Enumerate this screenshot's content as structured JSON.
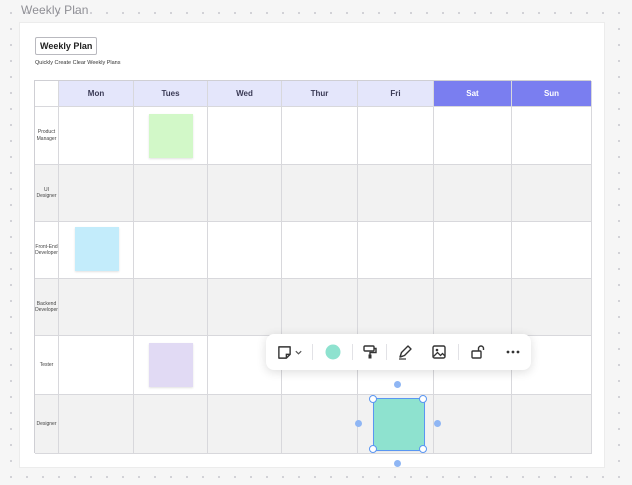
{
  "frame": {
    "title": "Weekly Plan"
  },
  "header": {
    "button_label": "Weekly Plan",
    "subtitle": "Quickly Create Clear Weekly Plans"
  },
  "days": [
    "Mon",
    "Tues",
    "Wed",
    "Thur",
    "Fri",
    "Sat",
    "Sun"
  ],
  "roles": [
    "Product Manager",
    "UI Designer",
    "Front-End Developer",
    "Backend Developer",
    "Tester",
    "Designer"
  ],
  "colors": {
    "header_weekday": "#e4e6fb",
    "header_weekend": "#7a7ef0",
    "row_shade": "#f2f2f2",
    "sticky_green": "#d2f8c8",
    "sticky_blue": "#c3ecfb",
    "sticky_purple": "#e1daf4",
    "sticky_selected": "#8ee2cf",
    "fill_swatch": "#8ee2cf",
    "selection": "#5a96f2"
  },
  "stickies": [
    {
      "role": "Product Manager",
      "day": "Tues",
      "color": "sticky_green",
      "text": ""
    },
    {
      "role": "Front-End Developer",
      "day": "Mon",
      "color": "sticky_blue",
      "text": ""
    },
    {
      "role": "Tester",
      "day": "Tues",
      "color": "sticky_purple",
      "text": ""
    },
    {
      "role": "Designer",
      "day": "Fri",
      "color": "sticky_selected",
      "text": "",
      "selected": true
    }
  ],
  "toolbar": {
    "items": [
      "sticky-note-icon",
      "chevron-down-icon",
      "fill-color-swatch",
      "format-painter-icon",
      "pen-icon",
      "image-icon",
      "unlock-icon",
      "more-icon"
    ]
  }
}
